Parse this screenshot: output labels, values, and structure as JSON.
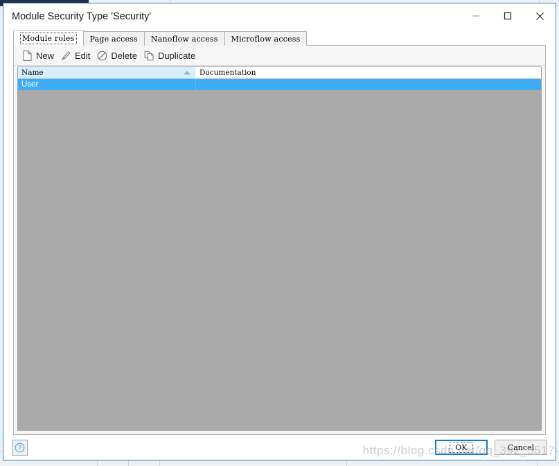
{
  "dialog": {
    "title": "Module Security Type 'Security'",
    "window_controls": [
      {
        "name": "minimize",
        "label": "–"
      },
      {
        "name": "maximize",
        "label": "□"
      },
      {
        "name": "close",
        "label": "✕"
      }
    ]
  },
  "tabs": [
    {
      "label": "Module roles",
      "active": true
    },
    {
      "label": "Page access",
      "active": false
    },
    {
      "label": "Nanoflow access",
      "active": false
    },
    {
      "label": "Microflow access",
      "active": false
    }
  ],
  "toolbar": {
    "new_label": "New",
    "edit_label": "Edit",
    "delete_label": "Delete",
    "duplicate_label": "Duplicate",
    "icons": {
      "new": "page-icon",
      "edit": "pencil-icon",
      "delete": "no-entry-icon",
      "duplicate": "copy-icon"
    }
  },
  "grid": {
    "columns": [
      {
        "label": "Name",
        "sorted": "ascending"
      },
      {
        "label": "Documentation",
        "sorted": "none"
      }
    ],
    "rows": [
      {
        "name": "User",
        "documentation": "",
        "selected": true
      }
    ]
  },
  "footer": {
    "help_label": "?",
    "ok_label": "OK",
    "cancel_label": "Cancel"
  },
  "watermark": {
    "text": "https://blog.csdn.net/qq_392_5517"
  },
  "colors": {
    "dialog_border": "#2e7fc1",
    "selection_blue": "#3daef5",
    "header_blue": "#d7eefb",
    "grid_empty_gray": "#aaaaaa",
    "default_button_border": "#0a7ad6",
    "help_icon_blue": "#3daef5"
  }
}
